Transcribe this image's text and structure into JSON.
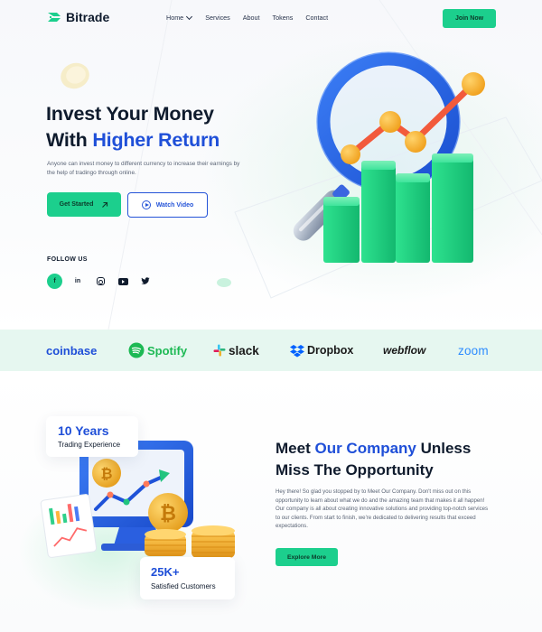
{
  "header": {
    "logo_text": "Bitrade",
    "nav": [
      "Home",
      "Services",
      "About",
      "Tokens",
      "Contact"
    ],
    "join_label": "Join Now"
  },
  "hero": {
    "title_line1": "Invest Your Money",
    "title_line2_prefix": "With ",
    "title_line2_highlight": "Higher Return",
    "description": "Anyone can invest money to different currency to increase their earnings by the help of tradingo through online.",
    "primary_button": "Get Started",
    "secondary_button": "Watch Video",
    "follow_label": "FOLLOW US",
    "socials": [
      "facebook-icon",
      "linkedin-icon",
      "instagram-icon",
      "youtube-icon",
      "twitter-icon"
    ]
  },
  "brands": [
    "coinbase",
    "Spotify",
    "slack",
    "Dropbox",
    "webflow",
    "zoom"
  ],
  "about": {
    "years_value": "10 Years",
    "years_label": "Trading Experience",
    "customers_value": "25K+",
    "customers_label": "Satisfied Customers",
    "title_prefix": "Meet ",
    "title_highlight": "Our Company",
    "title_suffix_line1": " Unless",
    "title_line2": "Miss The Opportunity",
    "description": "Hey there! So glad you stopped by to Meet Our Company. Don't miss out on this opportunity to learn about what we do and the amazing team that makes it all happen! Our company is all about creating innovative solutions and providing top-notch services to our clients. From start to finish, we're dedicated to delivering results that exceed expectations.",
    "button": "Explore More"
  },
  "colors": {
    "accent_green": "#1ccf8d",
    "accent_blue": "#1f4fd8",
    "brand_band": "#e6f7f0"
  }
}
